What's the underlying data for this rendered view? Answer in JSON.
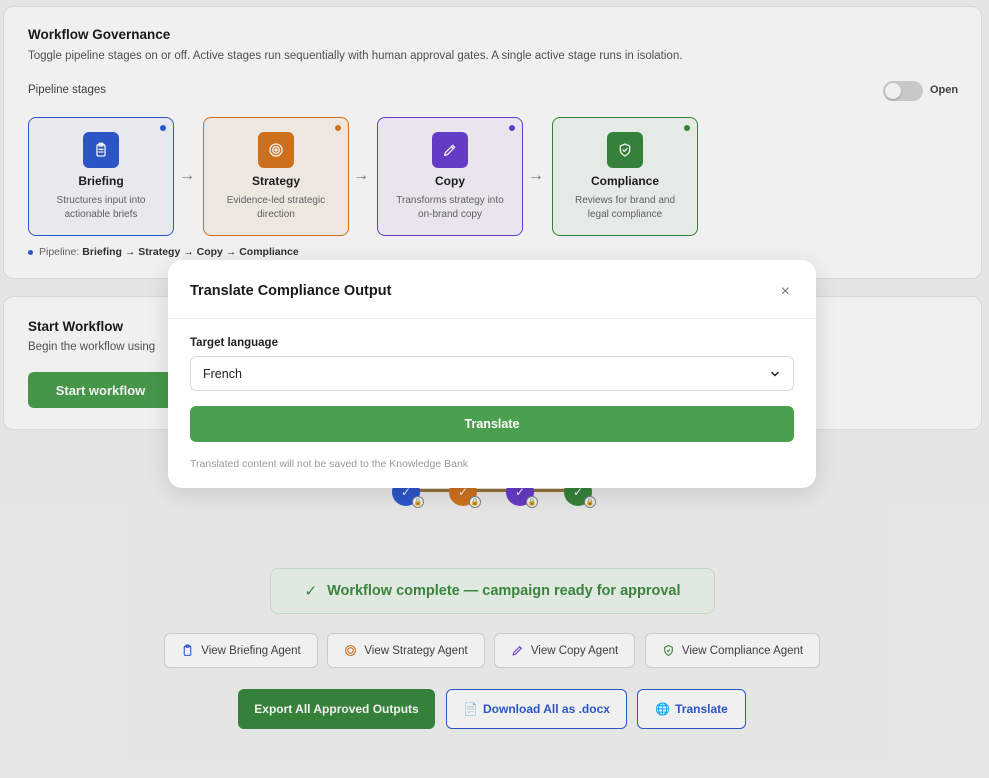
{
  "governance": {
    "title": "Workflow Governance",
    "subtitle": "Toggle pipeline stages on or off. Active stages run sequentially with human approval gates. A single active stage runs in isolation.",
    "stages_label": "Pipeline stages",
    "toggle_label": "Open",
    "stages": [
      {
        "name": "Briefing",
        "desc": "Structures input into actionable briefs",
        "color": "#2f5bd3",
        "icon": "clipboard-icon"
      },
      {
        "name": "Strategy",
        "desc": "Evidence-led strategic direction",
        "color": "#d9781f",
        "icon": "target-icon"
      },
      {
        "name": "Copy",
        "desc": "Transforms strategy into on-brand copy",
        "color": "#6b3fd1",
        "icon": "pencil-icon"
      },
      {
        "name": "Compliance",
        "desc": "Reviews for brand and legal compliance",
        "color": "#3a8a3e",
        "icon": "shield-check-icon"
      }
    ],
    "pipeline_prefix": "Pipeline:",
    "pipeline_value": "Briefing → Strategy → Copy → Compliance"
  },
  "start": {
    "title": "Start Workflow",
    "subtitle": "Begin the workflow using",
    "button_label": "Start workflow"
  },
  "status": {
    "complete_text": "Workflow complete — campaign ready for approval"
  },
  "agents": [
    {
      "label": "View Briefing Agent",
      "icon": "clipboard-icon"
    },
    {
      "label": "View Strategy Agent",
      "icon": "target-icon"
    },
    {
      "label": "View Copy Agent",
      "icon": "pencil-icon"
    },
    {
      "label": "View Compliance Agent",
      "icon": "shield-check-icon"
    }
  ],
  "actions": {
    "export_label": "Export All Approved Outputs",
    "download_label": "Download All as .docx",
    "translate_label": "Translate"
  },
  "modal": {
    "title": "Translate Compliance Output",
    "field_label": "Target language",
    "selected_language": "French",
    "button_label": "Translate",
    "note": "Translated content will not be saved to the Knowledge Bank"
  }
}
